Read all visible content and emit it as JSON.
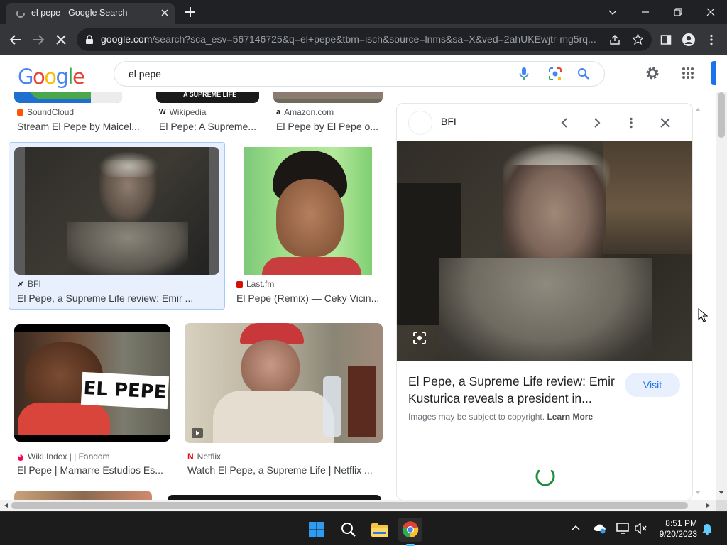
{
  "browser": {
    "tab_title": "el pepe - Google Search",
    "url_host": "google.com",
    "url_path": "/search?sca_esv=567146725&q=el+pepe&tbm=isch&source=lnms&sa=X&ved=2ahUKEwjtr-mg5rq..."
  },
  "google": {
    "logo": "Google",
    "query": "el pepe"
  },
  "results": {
    "row0": [
      {
        "source": "SoundCloud",
        "title": "Stream El Pepe by Maicel..."
      },
      {
        "source": "Wikipedia",
        "title": "El Pepe: A Supreme..."
      },
      {
        "source": "Amazon.com",
        "title": "El Pepe by El Pepe o..."
      }
    ],
    "row1": [
      {
        "source": "BFI",
        "title": "El Pepe, a Supreme Life review: Emir ..."
      },
      {
        "source": "Last.fm",
        "title": "El Pepe (Remix) — Ceky Vicin..."
      }
    ],
    "row2": [
      {
        "source": "Wiki Index | | Fandom",
        "title": "El Pepe | Mamarre Estudios Es...",
        "overlay_text": "EL PEPE"
      },
      {
        "source": "Netflix",
        "title": "Watch El Pepe, a Supreme Life | Netflix ..."
      }
    ],
    "wikipedia_thumb_text": "A SUPREME LIFE"
  },
  "panel": {
    "source": "BFI",
    "title": "El Pepe, a Supreme Life review: Emir Kusturica reveals a president in...",
    "visit_label": "Visit",
    "copyright": "Images may be subject to copyright.",
    "learn_more": "Learn More"
  },
  "taskbar": {
    "time": "8:51 PM",
    "date": "9/20/2023"
  },
  "colors": {
    "accent": "#1a73e8",
    "selected_bg": "#e8f0fe",
    "selected_border": "#a8c7fa",
    "loading": "#1e8e3e"
  }
}
